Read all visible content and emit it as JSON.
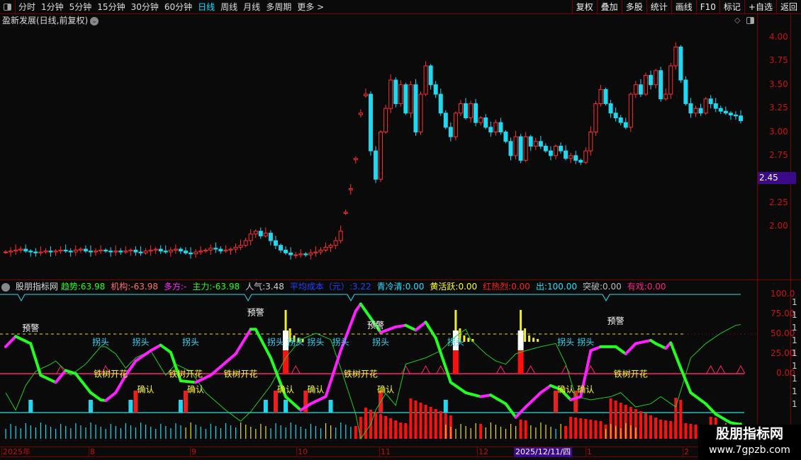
{
  "toolbar": {
    "periods": [
      "分时",
      "1分钟",
      "5分钟",
      "15分钟",
      "30分钟",
      "60分钟",
      "日线",
      "周线",
      "月线",
      "多周期",
      "更多 >"
    ],
    "active": "日线",
    "right_buttons": [
      "复权",
      "叠加",
      "多股",
      "统计",
      "画线",
      "F10",
      "标记",
      "+自选",
      "返回"
    ]
  },
  "title": "盈新发展(日线,前复权)",
  "price_axis": {
    "ticks": [
      "4.00",
      "3.75",
      "3.50",
      "3.25",
      "3.00",
      "2.75",
      "2.25",
      "2.00"
    ],
    "current": "2.45"
  },
  "indicator": {
    "name": "股朋指标网",
    "fields": [
      {
        "label": "趋势:",
        "value": "63.98",
        "color": "#20ff20"
      },
      {
        "label": "机构:",
        "value": "-63.98",
        "color": "#ff7070"
      },
      {
        "label": "多方:",
        "value": "-",
        "color": "#ff20ff"
      },
      {
        "label": "主力:",
        "value": "-63.98",
        "color": "#20ff20"
      },
      {
        "label": "人气:",
        "value": "3.48",
        "color": "#cccccc"
      },
      {
        "label": "平均成本（元）:",
        "value": "3.22",
        "color": "#2040ff"
      },
      {
        "label": "青冷清:",
        "value": "0.00",
        "color": "#20e0ff"
      },
      {
        "label": "黄活跃:",
        "value": "0.00",
        "color": "#ffff20"
      },
      {
        "label": "红热烈:",
        "value": "0.00",
        "color": "#ff2020"
      },
      {
        "label": "出:",
        "value": "100.00",
        "color": "#20e0ff"
      },
      {
        "label": "突破:",
        "value": "0.00",
        "color": "#bbbbbb"
      },
      {
        "label": "有戏:",
        "value": "0.00",
        "color": "#ff2080"
      }
    ],
    "ticks": [
      "100.0",
      "75.00",
      "50.00",
      "25.00",
      "0.00"
    ]
  },
  "time_axis": {
    "labels": [
      "2025年",
      "8",
      "9",
      "10",
      "11",
      "12",
      "1",
      "2"
    ],
    "highlight": "2025/12/11/四"
  },
  "watermark": {
    "name": "股朋指标网",
    "url": "www.7gpzb.com"
  },
  "side_column": [
    "1",
    "1",
    "1",
    "1",
    "1",
    "1",
    "1",
    "1",
    "1"
  ],
  "colors": {
    "up": "#ff3030",
    "down": "#20d8f0",
    "magenta": "#ff20ff",
    "green": "#20ff20",
    "thin": "#20cc20"
  },
  "chart_data": {
    "type": "candlestick",
    "closes": [
      1.73,
      1.74,
      1.75,
      1.76,
      1.74,
      1.73,
      1.72,
      1.73,
      1.74,
      1.73,
      1.74,
      1.75,
      1.74,
      1.73,
      1.75,
      1.76,
      1.74,
      1.73,
      1.74,
      1.75,
      1.74,
      1.73,
      1.74,
      1.73,
      1.74,
      1.75,
      1.73,
      1.72,
      1.74,
      1.75,
      1.76,
      1.74,
      1.73,
      1.75,
      1.76,
      1.74,
      1.72,
      1.71,
      1.73,
      1.74,
      1.75,
      1.77,
      1.76,
      1.74,
      1.75,
      1.76,
      1.78,
      1.8,
      1.85,
      1.92,
      1.95,
      1.9,
      1.93,
      1.85,
      1.8,
      1.75,
      1.72,
      1.7,
      1.7,
      1.71,
      1.7,
      1.72,
      1.73,
      1.75,
      1.78,
      1.8,
      1.85,
      1.95,
      2.15,
      2.4,
      2.72,
      3.2,
      3.4,
      2.8,
      2.5,
      3.0,
      3.25,
      3.55,
      3.3,
      3.5,
      3.2,
      3.5,
      3.0,
      3.4,
      3.7,
      3.5,
      3.4,
      3.2,
      3.05,
      2.95,
      3.2,
      3.3,
      3.15,
      3.3,
      3.1,
      3.15,
      3.05,
      3.0,
      3.1,
      3.0,
      2.9,
      2.75,
      2.95,
      2.7,
      2.95,
      2.85,
      2.9,
      2.85,
      2.8,
      2.75,
      2.85,
      2.8,
      2.72,
      2.75,
      2.7,
      2.68,
      2.8,
      3.0,
      3.3,
      3.45,
      3.3,
      3.2,
      3.15,
      3.1,
      3.05,
      3.4,
      3.5,
      3.4,
      3.6,
      3.5,
      3.65,
      3.35,
      3.4,
      3.7,
      3.9,
      3.55,
      3.3,
      3.2,
      3.25,
      3.2,
      3.35,
      3.3,
      3.25,
      3.22,
      3.2,
      3.18,
      3.17,
      3.12
    ],
    "trend_line": [
      [
        0,
        34
      ],
      [
        2,
        47
      ],
      [
        5,
        38
      ],
      [
        7,
        -2
      ],
      [
        10,
        -11
      ],
      [
        12,
        4
      ],
      [
        14,
        0
      ],
      [
        17,
        -24
      ],
      [
        19,
        -33
      ],
      [
        20,
        -34
      ],
      [
        22,
        -24
      ],
      [
        24,
        -2
      ],
      [
        26,
        16
      ],
      [
        29,
        29
      ],
      [
        31,
        36
      ],
      [
        33,
        27
      ],
      [
        35,
        -9
      ],
      [
        38,
        -11
      ],
      [
        41,
        -2
      ],
      [
        46,
        25
      ],
      [
        49,
        56
      ],
      [
        50,
        56
      ],
      [
        53,
        20
      ],
      [
        56,
        -29
      ],
      [
        59,
        -46
      ],
      [
        61,
        -38
      ],
      [
        64,
        -29
      ],
      [
        67,
        29
      ],
      [
        70,
        79
      ],
      [
        71,
        88
      ],
      [
        73,
        70
      ],
      [
        75,
        52
      ],
      [
        78,
        59
      ],
      [
        80,
        61
      ],
      [
        82,
        55
      ],
      [
        84,
        65
      ],
      [
        86,
        45
      ],
      [
        89,
        -11
      ],
      [
        92,
        -24
      ],
      [
        95,
        -29
      ],
      [
        97,
        -27
      ],
      [
        100,
        -38
      ],
      [
        102,
        -55
      ],
      [
        104,
        -42
      ],
      [
        107,
        -24
      ],
      [
        109,
        -15
      ],
      [
        111,
        -20
      ],
      [
        113,
        -33
      ],
      [
        115,
        -29
      ],
      [
        117,
        29
      ],
      [
        119,
        34
      ],
      [
        122,
        34
      ],
      [
        124,
        25
      ],
      [
        126,
        38
      ],
      [
        129,
        42
      ],
      [
        130,
        38
      ],
      [
        132,
        32
      ],
      [
        133,
        39
      ],
      [
        135,
        7
      ],
      [
        137,
        -24
      ],
      [
        140,
        -38
      ],
      [
        142,
        -51
      ],
      [
        145,
        -62
      ],
      [
        147,
        -64
      ]
    ],
    "thin_line": [
      [
        0,
        -24
      ],
      [
        2,
        -46
      ],
      [
        4,
        -15
      ],
      [
        6,
        3
      ],
      [
        9,
        12
      ],
      [
        10,
        16
      ],
      [
        13,
        -2
      ],
      [
        16,
        12
      ],
      [
        19,
        34
      ],
      [
        20,
        34
      ],
      [
        22,
        25
      ],
      [
        24,
        7
      ],
      [
        26,
        20
      ],
      [
        29,
        29
      ],
      [
        32,
        -2
      ],
      [
        34,
        12
      ],
      [
        37,
        3
      ],
      [
        40,
        -24
      ],
      [
        44,
        -46
      ],
      [
        47,
        -60
      ],
      [
        49,
        -48
      ],
      [
        53,
        -15
      ],
      [
        56,
        20
      ],
      [
        59,
        43
      ],
      [
        62,
        51
      ],
      [
        65,
        43
      ],
      [
        67,
        7
      ],
      [
        70,
        -51
      ],
      [
        71,
        -82
      ],
      [
        73,
        -64
      ],
      [
        74,
        -46
      ],
      [
        76,
        -25
      ],
      [
        78,
        -40
      ],
      [
        80,
        12
      ],
      [
        84,
        20
      ],
      [
        87,
        29
      ],
      [
        90,
        47
      ],
      [
        92,
        56
      ],
      [
        93,
        43
      ],
      [
        96,
        25
      ],
      [
        98,
        16
      ],
      [
        100,
        12
      ],
      [
        102,
        25
      ],
      [
        104,
        29
      ],
      [
        107,
        34
      ],
      [
        110,
        38
      ],
      [
        112,
        12
      ],
      [
        114,
        -29
      ],
      [
        117,
        -33
      ],
      [
        121,
        -29
      ],
      [
        123,
        -24
      ],
      [
        126,
        -42
      ],
      [
        129,
        -38
      ],
      [
        131,
        -29
      ],
      [
        134,
        -42
      ],
      [
        137,
        20
      ],
      [
        140,
        38
      ],
      [
        143,
        51
      ],
      [
        146,
        61
      ],
      [
        147,
        62
      ]
    ],
    "cyan_bars": [
      5,
      17,
      25,
      35,
      52,
      56,
      65,
      88,
      110
    ],
    "confirm_bars": [
      26,
      36,
      54,
      60,
      75,
      110,
      114
    ],
    "signal_bars": [
      56,
      90,
      103
    ],
    "triangles": [
      11,
      20,
      58,
      80,
      84,
      87,
      99,
      105,
      112,
      117,
      141,
      143,
      147
    ],
    "red_hist": [
      72,
      73,
      74,
      75,
      76,
      77,
      78,
      79,
      80,
      81,
      82,
      83,
      84,
      85,
      86,
      87,
      88,
      89,
      120,
      121,
      122,
      123,
      124,
      125,
      126,
      127,
      128,
      129,
      130,
      131,
      132,
      133,
      134,
      135
    ],
    "labels": [
      {
        "t": "预警",
        "i": 5,
        "v": 58,
        "c": "#ffffff"
      },
      {
        "t": "预警",
        "i": 50,
        "v": 78,
        "c": "#ffffff"
      },
      {
        "t": "预警",
        "i": 74,
        "v": 62,
        "c": "#ffffff"
      },
      {
        "t": "预警",
        "i": 122,
        "v": 67,
        "c": "#ffffff"
      },
      {
        "t": "拐头",
        "i": 19,
        "v": 40,
        "c": "#20e0ff"
      },
      {
        "t": "拐头",
        "i": 27,
        "v": 40,
        "c": "#20e0ff"
      },
      {
        "t": "拐头",
        "i": 37,
        "v": 40,
        "c": "#20e0ff"
      },
      {
        "t": "拐头",
        "i": 54,
        "v": 40,
        "c": "#20e0ff"
      },
      {
        "t": "拐头",
        "i": 58,
        "v": 40,
        "c": "#20e0ff"
      },
      {
        "t": "拐头",
        "i": 62,
        "v": 40,
        "c": "#20e0ff"
      },
      {
        "t": "拐头",
        "i": 67,
        "v": 40,
        "c": "#20e0ff"
      },
      {
        "t": "拐头",
        "i": 75,
        "v": 40,
        "c": "#20e0ff"
      },
      {
        "t": "拐头",
        "i": 90,
        "v": 40,
        "c": "#20e0ff"
      },
      {
        "t": "拐头",
        "i": 112,
        "v": 40,
        "c": "#20e0ff"
      },
      {
        "t": "拐头",
        "i": 116,
        "v": 40,
        "c": "#20e0ff"
      },
      {
        "t": "铁树开花",
        "i": 21,
        "v": 0,
        "c": "#ffff20"
      },
      {
        "t": "铁树开花",
        "i": 36,
        "v": 0,
        "c": "#ffff20"
      },
      {
        "t": "铁树开花",
        "i": 47,
        "v": 0,
        "c": "#ffff20"
      },
      {
        "t": "铁树开花",
        "i": 71,
        "v": 0,
        "c": "#ffff20"
      },
      {
        "t": "铁树开花",
        "i": 125,
        "v": 0,
        "c": "#ffff20"
      },
      {
        "t": "确认",
        "i": 28,
        "v": -20,
        "c": "#ffff20"
      },
      {
        "t": "确认",
        "i": 38,
        "v": -20,
        "c": "#ffff20"
      },
      {
        "t": "确认",
        "i": 56,
        "v": -20,
        "c": "#ffff20"
      },
      {
        "t": "确认",
        "i": 62,
        "v": -20,
        "c": "#ffff20"
      },
      {
        "t": "确认",
        "i": 76,
        "v": -20,
        "c": "#ffff20"
      },
      {
        "t": "确认",
        "i": 112,
        "v": -20,
        "c": "#ffff20"
      },
      {
        "t": "确认",
        "i": 116,
        "v": -20,
        "c": "#ffff20"
      }
    ],
    "bottom_colors": "ccccccccccccccccccccccccccccccccccccyycccccccccyyyyyycccccccccccyyccccrrrrrrrrrrrrrrrrrryyyyyyyryyyyyyyrryyyyycyrrrrrrrryyyyyyyrrrrrrrrrrrrrrrryyyyyyyy"
  }
}
